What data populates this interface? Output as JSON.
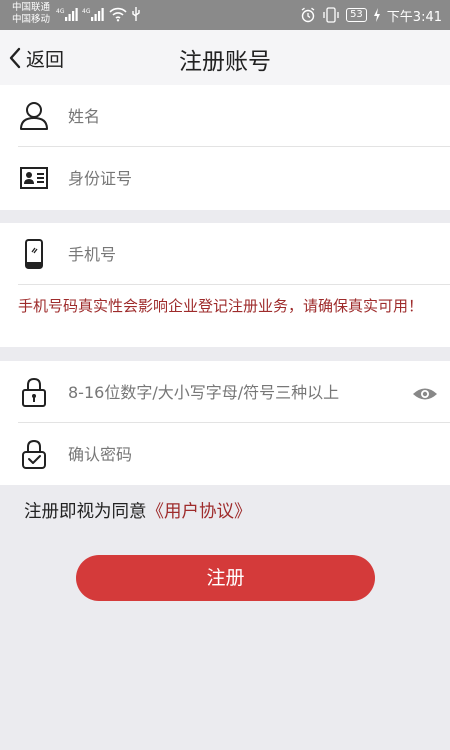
{
  "status_bar": {
    "carrier_1": "中国联通",
    "carrier_2": "中国移动",
    "network_1": "4G",
    "network_2": "4G",
    "battery": "53",
    "time": "下午3:41"
  },
  "nav": {
    "back_label": "返回",
    "title": "注册账号"
  },
  "form": {
    "name_placeholder": "姓名",
    "id_placeholder": "身份证号",
    "phone_placeholder": "手机号",
    "phone_warning": "手机号码真实性会影响企业登记注册业务，请确保真实可用！",
    "password_placeholder": "8-16位数字/大小写字母/符号三种以上",
    "confirm_placeholder": "确认密码"
  },
  "agreement": {
    "prefix": "注册即视为同意",
    "link": "《用户协议》"
  },
  "submit_label": "注册",
  "colors": {
    "accent": "#d43a3a",
    "warning_text": "#9e2b2b",
    "background": "#ebebef"
  }
}
